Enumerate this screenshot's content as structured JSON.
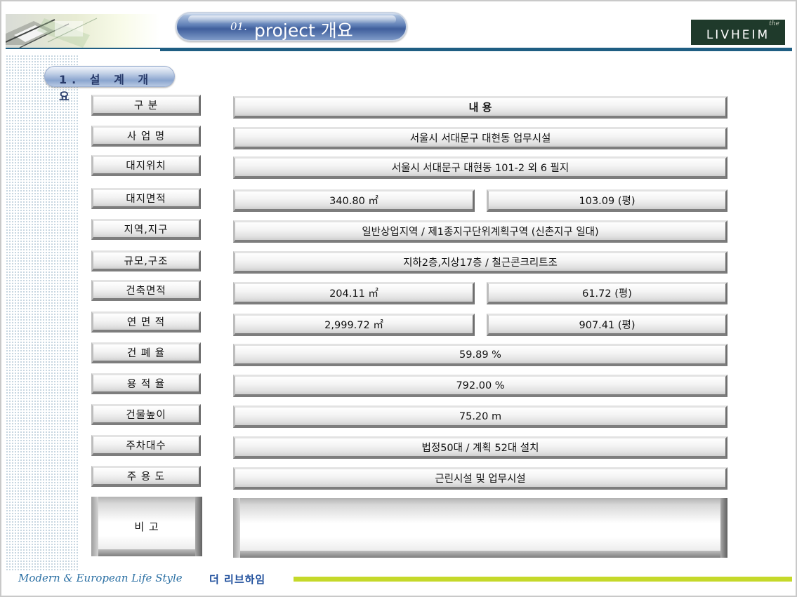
{
  "header": {
    "title_number": "01.",
    "title_text": "project 개요",
    "logo_the": "the",
    "logo_text": "LIVHEIM"
  },
  "section": {
    "title": "1. 설 계 개 요"
  },
  "table": {
    "header_label": "구   분",
    "header_value": "내             용",
    "rows": [
      {
        "label": "사 업 명",
        "value": "서울시 서대문구 대현동 업무시설"
      },
      {
        "label": "대지위치",
        "value": "서울시 서대문구 대현동 101-2 외 6 필지"
      },
      {
        "label": "대지면적",
        "value_m2": "340.80  ㎡",
        "value_py": "103.09 (평)"
      },
      {
        "label": "지역,지구",
        "value": "일반상업지역 / 제1종지구단위계획구역 (신촌지구 일대)"
      },
      {
        "label": "규모,구조",
        "value": "지하2층,지상17층 /  철근콘크리트조"
      },
      {
        "label": "건축면적",
        "value_m2": "204.11  ㎡",
        "value_py": "61.72 (평)"
      },
      {
        "label": "연 면 적",
        "value_m2": "2,999.72  ㎡",
        "value_py": "907.41 (평)"
      },
      {
        "label": "건 폐 율",
        "value": "59.89  %"
      },
      {
        "label": "용 적 율",
        "value": "792.00  %"
      },
      {
        "label": "건물높이",
        "value": "75.20  m"
      },
      {
        "label": "주차대수",
        "value": "법정50대   /  계획 52대 설치"
      },
      {
        "label": "주 용 도",
        "value": "근린시설 및 업무시설"
      }
    ],
    "remarks_label": "비     고",
    "remarks_value": ""
  },
  "footer": {
    "tagline": "Modern & European Life Style",
    "brand": "더 리브하임"
  },
  "colors": {
    "header_rule": "#1f5e83",
    "logo_bg": "#1f3a2b",
    "footer_bar": "#c5d92a",
    "tagline": "#2a6fa3"
  }
}
